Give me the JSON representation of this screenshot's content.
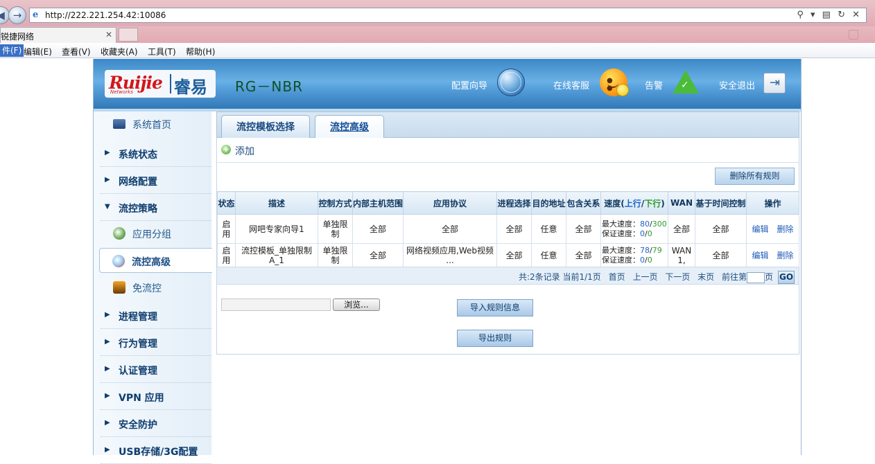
{
  "browser": {
    "url": "http://222.221.254.42:10086",
    "tab_title": "锐捷网络",
    "tab_close": "✕",
    "addr_tools": "⚲ ▾ ▤ ↻ ✕"
  },
  "menu": {
    "items": [
      "件(F)",
      "编辑(E)",
      "查看(V)",
      "收藏夹(A)",
      "工具(T)",
      "帮助(H)"
    ]
  },
  "header": {
    "logo_brand": "Ruijie",
    "logo_sub": "Networks",
    "logo_cn": "睿易",
    "model": "RG－NBR",
    "links": {
      "wizard": "配置向导",
      "support": "在线客服",
      "alert": "告警",
      "logout": "安全退出"
    }
  },
  "sidebar": {
    "home": "系统首页",
    "groups": [
      {
        "label": "系统状态",
        "arrow": "▶"
      },
      {
        "label": "网络配置",
        "arrow": "▶"
      },
      {
        "label": "流控策略",
        "arrow": "▼"
      }
    ],
    "sub_items": [
      "应用分组",
      "流控高级",
      "免流控"
    ],
    "groups_after": [
      {
        "label": "进程管理",
        "arrow": "▶"
      },
      {
        "label": "行为管理",
        "arrow": "▶"
      },
      {
        "label": "认证管理",
        "arrow": "▶"
      },
      {
        "label": "VPN 应用",
        "arrow": "▶"
      },
      {
        "label": "安全防护",
        "arrow": "▶"
      },
      {
        "label": "USB存储/3G配置",
        "arrow": "▶"
      }
    ]
  },
  "main": {
    "tabs": [
      "流控模板选择",
      "流控高级"
    ],
    "active_tab": 1,
    "add_label": "添加",
    "delete_all": "删除所有规则",
    "table": {
      "headers": [
        "状态",
        "描述",
        "控制方式",
        "内部主机范围",
        "应用协议",
        "进程选择",
        "目的地址",
        "包含关系",
        "速度(上行/下行)",
        "WAN",
        "基于时间控制",
        "操作"
      ],
      "speed_header": {
        "prefix": "速度(",
        "up": "上行",
        "slash": "/",
        "down": "下行",
        "suffix": ")"
      },
      "rows": [
        {
          "status": "启用",
          "desc": "网吧专家向导1",
          "control": "单独限制",
          "hosts": "全部",
          "protocol": "全部",
          "process": "全部",
          "dest": "任意",
          "include": "全部",
          "max_label": "最大速度：",
          "max_up": "80",
          "max_sep": "/",
          "max_down": "300",
          "guar_label": "保证速度：",
          "guar_up": "0",
          "guar_sep": "/",
          "guar_down": "0",
          "wan": "全部",
          "time": "全部",
          "edit": "编辑",
          "delete": "删除"
        },
        {
          "status": "启用",
          "desc": "流控模板_单独限制A_1",
          "control": "单独限制",
          "hosts": "全部",
          "protocol": "网络视频应用,Web视频 ...",
          "process": "全部",
          "dest": "任意",
          "include": "全部",
          "max_label": "最大速度：",
          "max_up": "78",
          "max_sep": "/",
          "max_down": "79",
          "guar_label": "保证速度：",
          "guar_up": "0",
          "guar_sep": "/",
          "guar_down": "0",
          "wan": "WAN 1,",
          "time": "全部",
          "edit": "编辑",
          "delete": "删除"
        }
      ]
    },
    "pager": {
      "summary": "共:2条记录 当前1/1页",
      "first": "首页",
      "prev": "上一页",
      "next": "下一页",
      "last": "末页",
      "goto_prefix": "前往第",
      "goto_suffix": "页",
      "go": "GO"
    },
    "browse_button": "浏览...",
    "import_button": "导入规则信息",
    "export_button": "导出规则"
  }
}
